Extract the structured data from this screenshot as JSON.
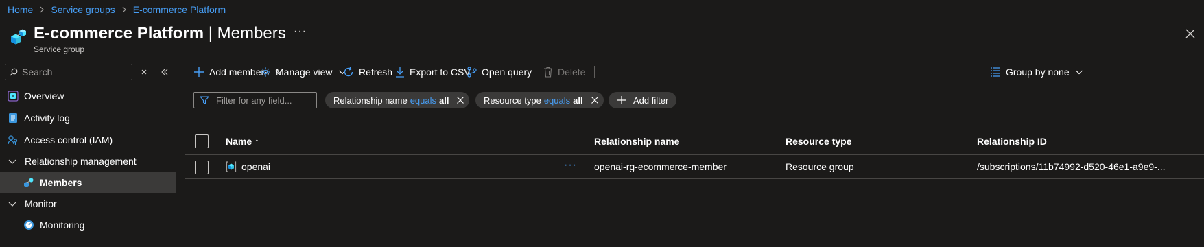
{
  "breadcrumb": [
    "Home",
    "Service groups",
    "E-commerce Platform"
  ],
  "header": {
    "title": "E-commerce Platform",
    "title_suffix": "| Members",
    "more": "···",
    "subtitle": "Service group"
  },
  "sidebar": {
    "search_placeholder": "Search",
    "items": [
      {
        "label": "Overview",
        "icon": "overview-icon"
      },
      {
        "label": "Activity log",
        "icon": "activity-log-icon"
      },
      {
        "label": "Access control (IAM)",
        "icon": "access-control-icon"
      },
      {
        "label": "Relationship management",
        "icon": "chevron-down-icon"
      },
      {
        "label": "Members",
        "icon": "members-icon",
        "selected": true
      },
      {
        "label": "Monitor",
        "icon": "chevron-down-icon"
      },
      {
        "label": "Monitoring",
        "icon": "monitoring-icon"
      }
    ]
  },
  "toolbar": {
    "add_members": "Add members",
    "manage_view": "Manage view",
    "refresh": "Refresh",
    "export_csv": "Export to CSV",
    "open_query": "Open query",
    "delete": "Delete",
    "group_by": "Group by none"
  },
  "filters": {
    "placeholder": "Filter for any field...",
    "pills": [
      {
        "field": "Relationship name",
        "op": "equals",
        "value": "all"
      },
      {
        "field": "Resource type",
        "op": "equals",
        "value": "all"
      }
    ],
    "add_filter": "Add filter"
  },
  "table": {
    "columns": [
      "Name ↑",
      "Relationship name",
      "Resource type",
      "Relationship ID"
    ],
    "rows": [
      {
        "name": "openai",
        "more": "···",
        "relationship_name": "openai-rg-ecommerce-member",
        "resource_type": "Resource group",
        "relationship_id": "/subscriptions/11b74992-d520-46e1-a9e9-..."
      }
    ]
  },
  "colors": {
    "background": "#1b1a19",
    "link": "#479ef5",
    "selected_nav": "#3b3a39",
    "pill": "#3b3a39"
  }
}
